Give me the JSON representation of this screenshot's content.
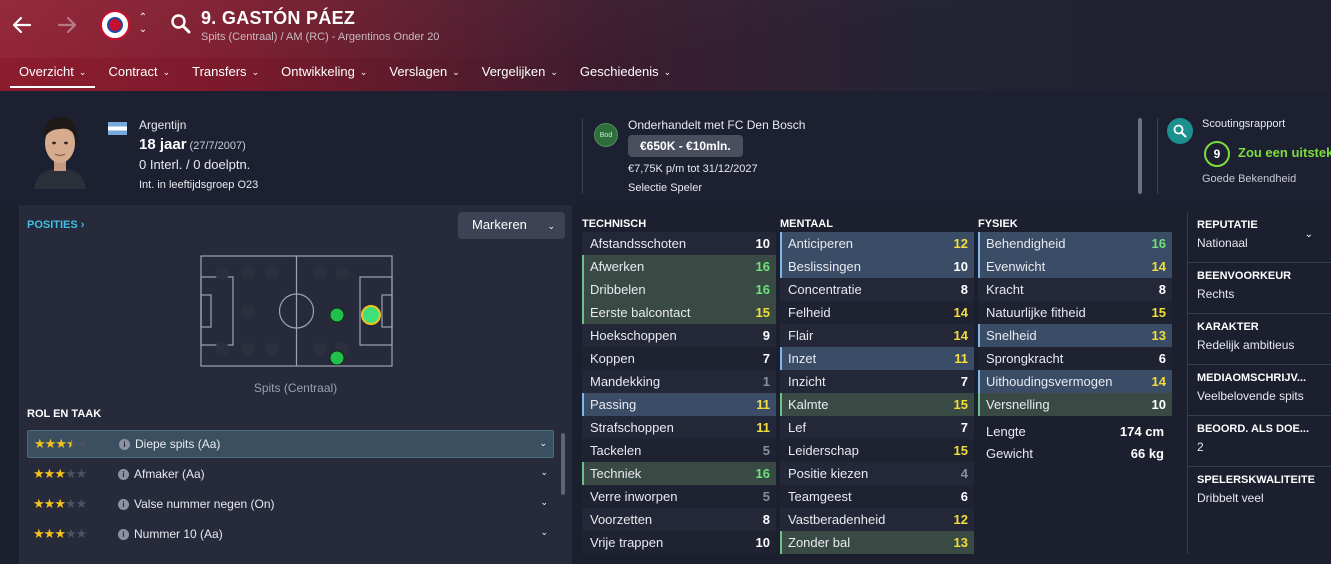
{
  "header": {
    "player_name": "9. GASTÓN PÁEZ",
    "player_sub": "Spits (Centraal) / AM (RC) - Argentinos Onder 20",
    "tabs": [
      {
        "label": "Overzicht"
      },
      {
        "label": "Contract"
      },
      {
        "label": "Transfers"
      },
      {
        "label": "Ontwikkeling"
      },
      {
        "label": "Verslagen"
      },
      {
        "label": "Vergelijken"
      },
      {
        "label": "Geschiedenis"
      }
    ],
    "icons": [
      "back-arrow-icon",
      "forward-arrow-icon",
      "club-crest-icon",
      "switch-player-icon",
      "search-icon"
    ]
  },
  "info": {
    "nationality": "Argentijn",
    "age": "18 jaar",
    "dob": "(27/7/2007)",
    "caps": "0 Interl. / 0 doelptn.",
    "intl_group": "Int. in leeftijdsgroep O23"
  },
  "bid": {
    "badge": "Bod",
    "title": "Onderhandelt met FC Den Bosch",
    "value": "€650K - €10mln.",
    "wage": "€7,75K p/m tot 31/12/2027",
    "selection": "Selectie Speler"
  },
  "scout": {
    "title": "Scoutingsrapport",
    "rating": "9",
    "verdict": "Zou een uitstek",
    "knowledge": "Goede Bekendheid"
  },
  "positions": {
    "title": "POSITIES ›",
    "mark_button": "Markeren",
    "pitch_label": "Spits (Centraal)",
    "colors": {
      "natural": "#3fe07a",
      "accomplished": "#22c04a",
      "empty": "#2b2f3e"
    }
  },
  "roles": {
    "title": "ROL EN TAAK",
    "items": [
      {
        "name": "Diepe spits (Aa)",
        "stars": 3.5
      },
      {
        "name": "Afmaker (Aa)",
        "stars": 3
      },
      {
        "name": "Valse nummer negen (On)",
        "stars": 3
      },
      {
        "name": "Nummer 10 (Aa)",
        "stars": 3
      }
    ]
  },
  "technical": {
    "title": "TECHNISCH",
    "rows": [
      {
        "name": "Afstandsschoten",
        "value": "10",
        "color": "white",
        "hl": ""
      },
      {
        "name": "Afwerken",
        "value": "16",
        "color": "green",
        "hl": "green"
      },
      {
        "name": "Dribbelen",
        "value": "16",
        "color": "green",
        "hl": "green"
      },
      {
        "name": "Eerste balcontact",
        "value": "15",
        "color": "yellow",
        "hl": "green"
      },
      {
        "name": "Hoekschoppen",
        "value": "9",
        "color": "white",
        "hl": ""
      },
      {
        "name": "Koppen",
        "value": "7",
        "color": "white",
        "hl": ""
      },
      {
        "name": "Mandekking",
        "value": "1",
        "color": "grey",
        "hl": ""
      },
      {
        "name": "Passing",
        "value": "11",
        "color": "yellow",
        "hl": "blue"
      },
      {
        "name": "Strafschoppen",
        "value": "11",
        "color": "yellow",
        "hl": ""
      },
      {
        "name": "Tackelen",
        "value": "5",
        "color": "grey",
        "hl": ""
      },
      {
        "name": "Techniek",
        "value": "16",
        "color": "green",
        "hl": "green"
      },
      {
        "name": "Verre inworpen",
        "value": "5",
        "color": "grey",
        "hl": ""
      },
      {
        "name": "Voorzetten",
        "value": "8",
        "color": "white",
        "hl": ""
      },
      {
        "name": "Vrije trappen",
        "value": "10",
        "color": "white",
        "hl": ""
      }
    ]
  },
  "mental": {
    "title": "MENTAAL",
    "rows": [
      {
        "name": "Anticiperen",
        "value": "12",
        "color": "yellow",
        "hl": "blue"
      },
      {
        "name": "Beslissingen",
        "value": "10",
        "color": "white",
        "hl": "blue"
      },
      {
        "name": "Concentratie",
        "value": "8",
        "color": "white",
        "hl": ""
      },
      {
        "name": "Felheid",
        "value": "14",
        "color": "yellow",
        "hl": ""
      },
      {
        "name": "Flair",
        "value": "14",
        "color": "yellow",
        "hl": ""
      },
      {
        "name": "Inzet",
        "value": "11",
        "color": "yellow",
        "hl": "blue"
      },
      {
        "name": "Inzicht",
        "value": "7",
        "color": "white",
        "hl": ""
      },
      {
        "name": "Kalmte",
        "value": "15",
        "color": "yellow",
        "hl": "green"
      },
      {
        "name": "Lef",
        "value": "7",
        "color": "white",
        "hl": ""
      },
      {
        "name": "Leiderschap",
        "value": "15",
        "color": "yellow",
        "hl": ""
      },
      {
        "name": "Positie kiezen",
        "value": "4",
        "color": "grey",
        "hl": ""
      },
      {
        "name": "Teamgeest",
        "value": "6",
        "color": "white",
        "hl": ""
      },
      {
        "name": "Vastberadenheid",
        "value": "12",
        "color": "yellow",
        "hl": ""
      },
      {
        "name": "Zonder bal",
        "value": "13",
        "color": "yellow",
        "hl": "green"
      }
    ]
  },
  "physical": {
    "title": "FYSIEK",
    "rows": [
      {
        "name": "Behendigheid",
        "value": "16",
        "color": "green",
        "hl": "blue"
      },
      {
        "name": "Evenwicht",
        "value": "14",
        "color": "yellow",
        "hl": "blue"
      },
      {
        "name": "Kracht",
        "value": "8",
        "color": "white",
        "hl": ""
      },
      {
        "name": "Natuurlijke fitheid",
        "value": "15",
        "color": "yellow",
        "hl": ""
      },
      {
        "name": "Snelheid",
        "value": "13",
        "color": "yellow",
        "hl": "blue"
      },
      {
        "name": "Sprongkracht",
        "value": "6",
        "color": "white",
        "hl": ""
      },
      {
        "name": "Uithoudingsvermogen",
        "value": "14",
        "color": "yellow",
        "hl": "blue"
      },
      {
        "name": "Versnelling",
        "value": "10",
        "color": "white",
        "hl": "green"
      }
    ],
    "length_label": "Lengte",
    "length": "174 cm",
    "weight_label": "Gewicht",
    "weight": "66 kg"
  },
  "profile": [
    {
      "label": "REPUTATIE",
      "value": "Nationaal",
      "chevron": true
    },
    {
      "label": "BEENVOORKEUR",
      "value": "Rechts",
      "chevron": false
    },
    {
      "label": "KARAKTER",
      "value": "Redelijk ambitieus",
      "chevron": false
    },
    {
      "label": "MEDIAOMSCHRIJV...",
      "value": "Veelbelovende spits",
      "chevron": false
    },
    {
      "label": "BEOORD. ALS DOE...",
      "value": "2",
      "chevron": false
    },
    {
      "label": "SPELERSKWALITEITE",
      "value": "Dribbelt veel",
      "chevron": false
    }
  ]
}
